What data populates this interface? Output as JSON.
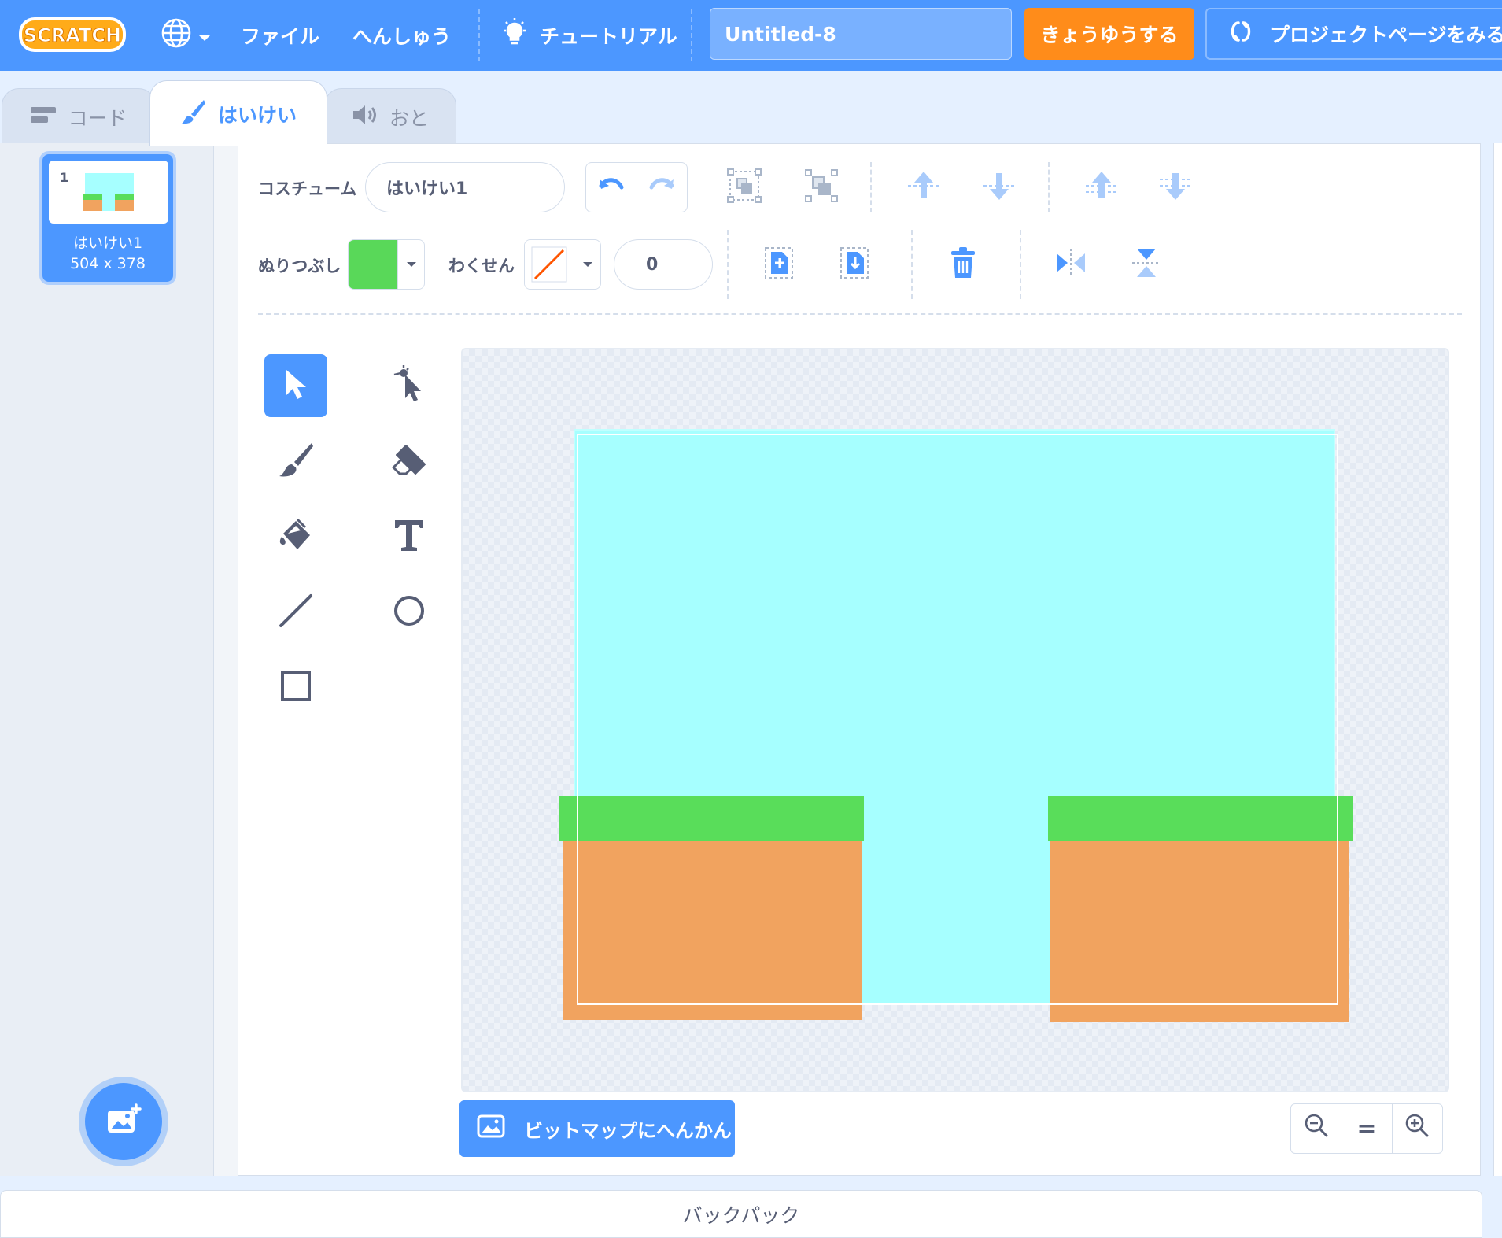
{
  "menubar": {
    "logo": "SCRATCH",
    "language_icon": "globe-icon",
    "file": "ファイル",
    "edit": "へんしゅう",
    "tutorials": "チュートリアル",
    "project_title": "Untitled-8",
    "share": "きょうゆうする",
    "see_project_page": "プロジェクトページをみる"
  },
  "tabs": {
    "code": "コード",
    "costumes": "はいけい",
    "sounds": "おと",
    "active": "costumes"
  },
  "costume_list": {
    "items": [
      {
        "number": "1",
        "name": "はいけい1",
        "size": "504 x 378",
        "selected": true
      }
    ]
  },
  "paint_editor": {
    "costume_label": "コスチューム",
    "costume_name": "はいけい1",
    "fill_label": "ぬりつぶし",
    "fill_color": "#59d859",
    "outline_label": "わくせん",
    "outline_color": "none",
    "outline_width": "0",
    "selected_tool": "select",
    "convert_button": "ビットマップにへんかん",
    "zoom_reset": "="
  },
  "artwork_colors": {
    "sky": "#a6ffff",
    "grass": "#59dd5a",
    "dirt": "#f1a35f"
  },
  "backpack": "バックパック"
}
